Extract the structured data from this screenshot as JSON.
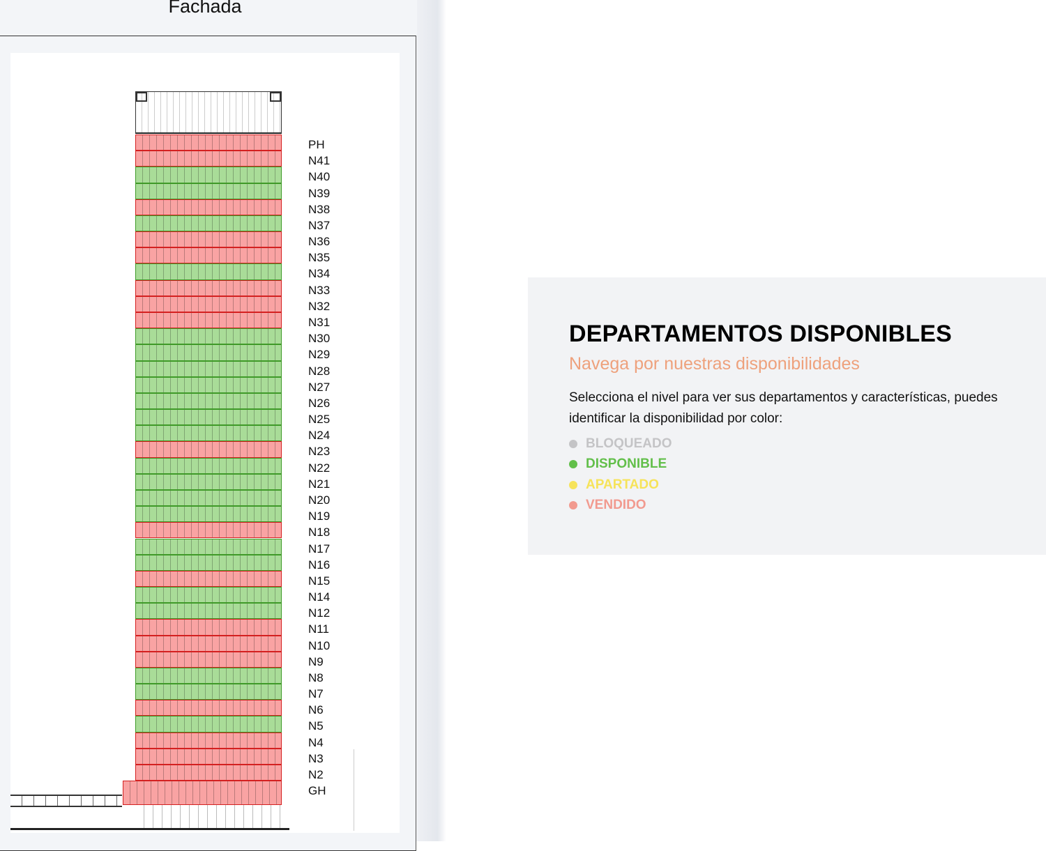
{
  "facade": {
    "title": "Fachada",
    "floors": [
      {
        "label": "PH",
        "status": "vendido"
      },
      {
        "label": "N41",
        "status": "vendido"
      },
      {
        "label": "N40",
        "status": "disponible"
      },
      {
        "label": "N39",
        "status": "disponible"
      },
      {
        "label": "N38",
        "status": "vendido"
      },
      {
        "label": "N37",
        "status": "disponible"
      },
      {
        "label": "N36",
        "status": "vendido"
      },
      {
        "label": "N35",
        "status": "vendido"
      },
      {
        "label": "N34",
        "status": "disponible"
      },
      {
        "label": "N33",
        "status": "vendido"
      },
      {
        "label": "N32",
        "status": "vendido"
      },
      {
        "label": "N31",
        "status": "vendido"
      },
      {
        "label": "N30",
        "status": "disponible"
      },
      {
        "label": "N29",
        "status": "disponible"
      },
      {
        "label": "N28",
        "status": "disponible"
      },
      {
        "label": "N27",
        "status": "disponible"
      },
      {
        "label": "N26",
        "status": "disponible"
      },
      {
        "label": "N25",
        "status": "disponible"
      },
      {
        "label": "N24",
        "status": "disponible"
      },
      {
        "label": "N23",
        "status": "vendido"
      },
      {
        "label": "N22",
        "status": "disponible"
      },
      {
        "label": "N21",
        "status": "disponible"
      },
      {
        "label": "N20",
        "status": "disponible"
      },
      {
        "label": "N19",
        "status": "disponible"
      },
      {
        "label": "N18",
        "status": "vendido"
      },
      {
        "label": "N17",
        "status": "disponible"
      },
      {
        "label": "N16",
        "status": "disponible"
      },
      {
        "label": "N15",
        "status": "vendido"
      },
      {
        "label": "N14",
        "status": "disponible"
      },
      {
        "label": "N12",
        "status": "disponible"
      },
      {
        "label": "N11",
        "status": "vendido"
      },
      {
        "label": "N10",
        "status": "vendido"
      },
      {
        "label": "N9",
        "status": "vendido"
      },
      {
        "label": "N8",
        "status": "disponible"
      },
      {
        "label": "N7",
        "status": "disponible"
      },
      {
        "label": "N6",
        "status": "vendido"
      },
      {
        "label": "N5",
        "status": "disponible"
      },
      {
        "label": "N4",
        "status": "vendido"
      },
      {
        "label": "N3",
        "status": "vendido"
      },
      {
        "label": "N2",
        "status": "vendido"
      },
      {
        "label": "GH",
        "status": "vendido"
      }
    ]
  },
  "info": {
    "heading": "DEPARTAMENTOS DISPONIBLES",
    "subheading": "Navega por nuestras disponibilidades",
    "description": "Selecciona el nivel para ver sus departamentos y características, puedes identificar la disponibilidad por color:",
    "legend": [
      {
        "label": "BLOQUEADO",
        "color": "#c4c4c6"
      },
      {
        "label": "DISPONIBLE",
        "color": "#62bf4a"
      },
      {
        "label": "APARTADO",
        "color": "#f6e35a"
      },
      {
        "label": "VENDIDO",
        "color": "#f29a8f"
      }
    ]
  }
}
